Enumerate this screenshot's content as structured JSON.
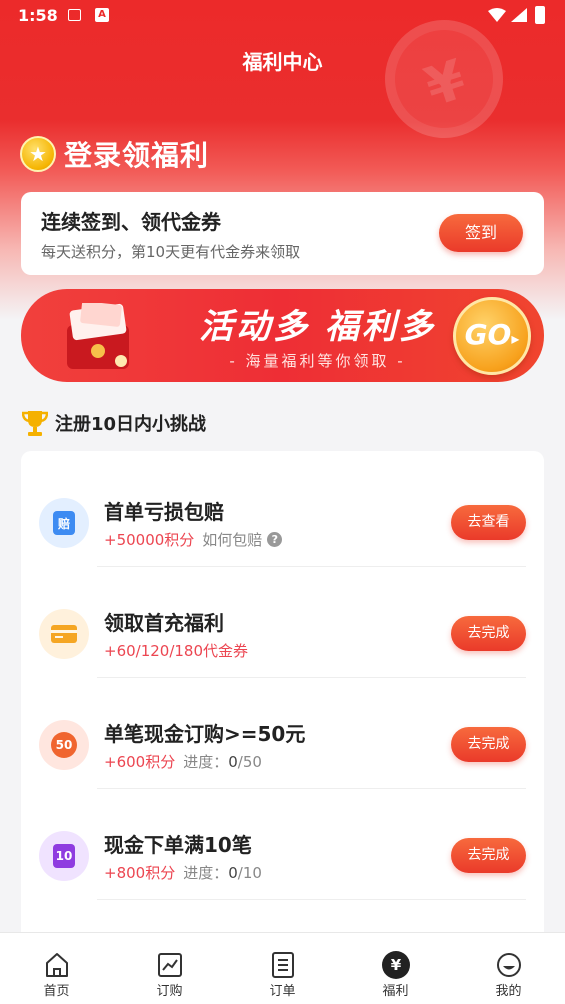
{
  "status_bar": {
    "time": "1:58",
    "notif_icon_letter": "A"
  },
  "header": {
    "title": "福利中心",
    "coin_symbol": "¥"
  },
  "login": {
    "title": "登录领福利",
    "badge_glyph": "★"
  },
  "sign_card": {
    "title": "连续签到、领代金券",
    "subtitle": "每天送积分，第10天更有代金券来领取",
    "button": "签到"
  },
  "banner": {
    "title": "活动多 福利多",
    "subtitle": "- 海量福利等你领取 -",
    "go_label": "GO",
    "go_arrow": "▸"
  },
  "section": {
    "title": "注册10日内小挑战"
  },
  "tasks": [
    {
      "icon": "compensation-icon",
      "icon_text": "赔",
      "icon_bg": "#e3efff",
      "icon_color": "#3d8bf2",
      "title": "首单亏损包赔",
      "reward": "+50000积分",
      "extra": "如何包赔",
      "help": "?",
      "button": "去查看"
    },
    {
      "icon": "card-icon",
      "icon_text": "",
      "icon_bg": "#fff1dc",
      "icon_color": "#f5a623",
      "title": "领取首充福利",
      "reward": "+60/120/180代金券",
      "button": "去完成"
    },
    {
      "icon": "badge-50-icon",
      "icon_text": "50",
      "icon_bg": "#ffe6df",
      "icon_color": "#f0652f",
      "title": "单笔现金订购>=50元",
      "reward": "+600积分",
      "progress_label": "进度：",
      "progress": "0",
      "total": "/50",
      "button": "去完成"
    },
    {
      "icon": "badge-10-icon",
      "icon_text": "10",
      "icon_bg": "#f0e3ff",
      "icon_color": "#8f3ce0",
      "title": "现金下单满10笔",
      "reward": "+800积分",
      "progress_label": "进度：",
      "progress": "0",
      "total": "/10",
      "button": "去完成"
    }
  ],
  "tabbar": [
    {
      "label": "首页",
      "icon": "home-icon",
      "active": false
    },
    {
      "label": "订购",
      "icon": "chart-icon",
      "active": false
    },
    {
      "label": "订单",
      "icon": "orders-icon",
      "active": false
    },
    {
      "label": "福利",
      "icon": "yen-coin-icon",
      "active": true,
      "glyph": "¥"
    },
    {
      "label": "我的",
      "icon": "profile-icon",
      "active": false
    }
  ]
}
